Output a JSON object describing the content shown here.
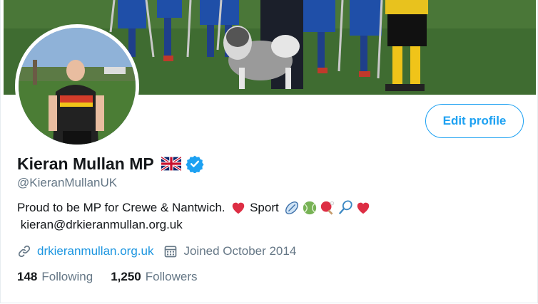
{
  "profile": {
    "name": "Kieran Mullan MP",
    "handle": "@KieranMullanUK",
    "flag_icon": "uk-flag-icon",
    "verified_icon": "verified-badge-icon",
    "bio_line1": "Proud to be MP for Crewe & Nantwich. ",
    "bio_line1_sport": " Sport ",
    "bio_line2": " kieran@drkieranmullan.org.uk",
    "emojis": [
      "red-heart-icon",
      "rugby-ball-icon",
      "tennis-ball-icon",
      "ping-pong-icon",
      "badminton-icon",
      "red-heart-icon"
    ],
    "website": "drkieranmullan.org.uk",
    "joined": "Joined October 2014"
  },
  "actions": {
    "edit_profile": "Edit profile"
  },
  "stats": {
    "following_count": "148",
    "following_label": "Following",
    "followers_count": "1,250",
    "followers_label": "Followers"
  },
  "colors": {
    "accent": "#1da1f2",
    "link": "#1b95e0",
    "secondary_text": "#657786",
    "heart": "#e0245e"
  }
}
